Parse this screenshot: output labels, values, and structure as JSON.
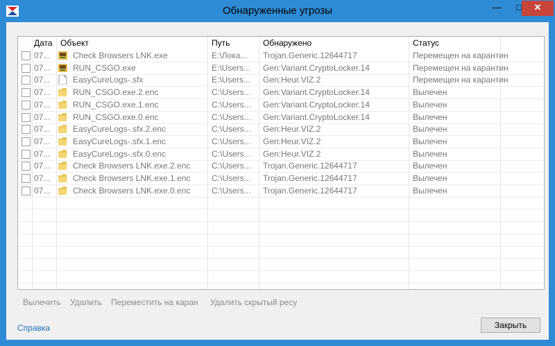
{
  "window": {
    "title": "Обнаруженные угрозы",
    "minimize": "—",
    "maximize": "□",
    "close": "✕"
  },
  "table": {
    "headers": {
      "date": "Дата",
      "object": "Объект",
      "path": "Путь",
      "detected": "Обнаружено",
      "status": "Статус"
    },
    "rows": [
      {
        "date": "07...",
        "object": "Check Browsers LNK.exe",
        "path": "E:\\Лока...",
        "detected": "Trojan.Generic.12644717",
        "status": "Перемещен на карантин",
        "icon": "exe-app-icon"
      },
      {
        "date": "07...",
        "object": "RUN_CSGO.exe",
        "path": "E:\\Users...",
        "detected": "Gen:Variant.CryptoLocker.14",
        "status": "Перемещен на карантин",
        "icon": "exe-app-icon"
      },
      {
        "date": "07...",
        "object": "EasyCureLogs-.sfx",
        "path": "E:\\Users...",
        "detected": "Gen:Heur.VIZ.2",
        "status": "Перемещен на карантин",
        "icon": "file-icon"
      },
      {
        "date": "07...",
        "object": "RUN_CSGO.exe.2.enc",
        "path": "C:\\Users...",
        "detected": "Gen:Variant.CryptoLocker.14",
        "status": "Вылечен",
        "icon": "folder-icon"
      },
      {
        "date": "07...",
        "object": "RUN_CSGO.exe.1.enc",
        "path": "C:\\Users...",
        "detected": "Gen:Variant.CryptoLocker.14",
        "status": "Вылечен",
        "icon": "folder-icon"
      },
      {
        "date": "07...",
        "object": "RUN_CSGO.exe.0.enc",
        "path": "C:\\Users...",
        "detected": "Gen:Variant.CryptoLocker.14",
        "status": "Вылечен",
        "icon": "folder-icon"
      },
      {
        "date": "07...",
        "object": "EasyCureLogs-.sfx.2.enc",
        "path": "C:\\Users...",
        "detected": "Gen:Heur.VIZ.2",
        "status": "Вылечен",
        "icon": "folder-icon"
      },
      {
        "date": "07...",
        "object": "EasyCureLogs-.sfx.1.enc",
        "path": "C:\\Users...",
        "detected": "Gen:Heur.VIZ.2",
        "status": "Вылечен",
        "icon": "folder-icon"
      },
      {
        "date": "07...",
        "object": "EasyCureLogs-.sfx.0.enc",
        "path": "C:\\Users...",
        "detected": "Gen:Heur.VIZ.2",
        "status": "Вылечен",
        "icon": "folder-icon"
      },
      {
        "date": "07...",
        "object": "Check Browsers LNK.exe.2.enc",
        "path": "C:\\Users...",
        "detected": "Trojan.Generic.12644717",
        "status": "Вылечен",
        "icon": "folder-icon"
      },
      {
        "date": "07...",
        "object": "Check Browsers LNK.exe.1.enc",
        "path": "C:\\Users...",
        "detected": "Trojan.Generic.12644717",
        "status": "Вылечен",
        "icon": "folder-icon"
      },
      {
        "date": "07...",
        "object": "Check Browsers LNK.exe.0.enc",
        "path": "C:\\Users...",
        "detected": "Trojan.Generic.12644717",
        "status": "Вылечен",
        "icon": "folder-icon"
      }
    ]
  },
  "toolbar": {
    "cure": "Вылечить",
    "delete": "Удалить",
    "move": "Переместить на каран",
    "delete_hidden": "Удалить скрытый ресу"
  },
  "footer": {
    "help": "Справка",
    "close": "Закрыть"
  },
  "colors": {
    "titlebar": "#2e8bd6",
    "close_button": "#c7453b",
    "link": "#1e73c2"
  }
}
